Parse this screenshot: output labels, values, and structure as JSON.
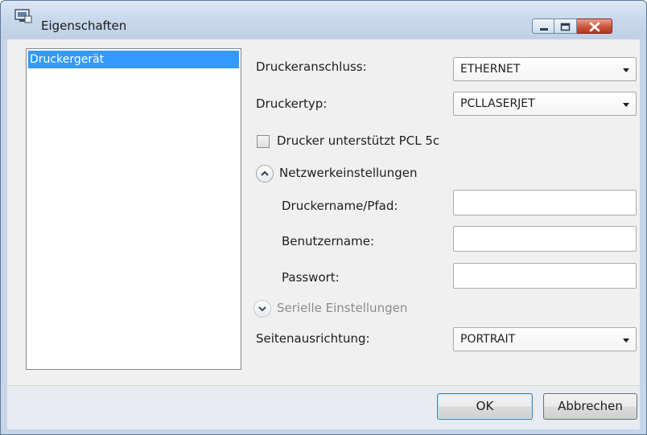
{
  "window": {
    "title": "Eigenschaften"
  },
  "sidebar": {
    "items": [
      {
        "label": "Druckergerät",
        "selected": true
      }
    ]
  },
  "form": {
    "port": {
      "label": "Druckeranschluss:",
      "value": "ETHERNET"
    },
    "type": {
      "label": "Druckertyp:",
      "value": "PCLLASERJET"
    },
    "pcl5c": {
      "label": "Drucker unterstützt PCL 5c",
      "checked": false
    },
    "network": {
      "header": "Netzwerkeinstellungen",
      "expanded": true,
      "printer_path_label": "Druckername/Pfad:",
      "printer_path_value": "",
      "username_label": "Benutzername:",
      "username_value": "",
      "password_label": "Passwort:",
      "password_value": ""
    },
    "serial": {
      "header": "Serielle Einstellungen",
      "expanded": false,
      "enabled": false
    },
    "orientation": {
      "label": "Seitenausrichtung:",
      "value": "PORTRAIT"
    }
  },
  "buttons": {
    "ok": "OK",
    "cancel": "Abbrechen"
  },
  "icons": {
    "app": "printer-properties-icon",
    "minimize": "minimize-icon",
    "maximize": "maximize-icon",
    "close": "close-icon",
    "dropdown": "chevron-down-icon",
    "collapse": "chevron-up-icon",
    "expand": "chevron-down-icon"
  },
  "colors": {
    "selection": "#3399ff",
    "close_button": "#c9553c",
    "titlebar": "#cad9ec"
  }
}
